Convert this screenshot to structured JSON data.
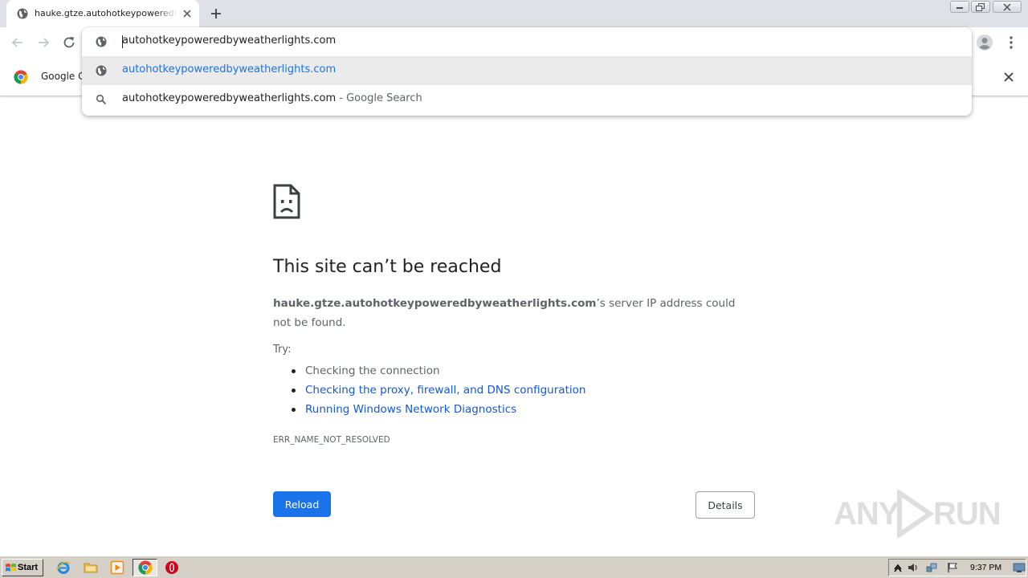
{
  "browser": {
    "tab": {
      "title": "hauke.gtze.autohotkeypoweredbyweatherlights.com"
    },
    "bookmark": {
      "label": "Google Chrome"
    }
  },
  "omnibox": {
    "input_value": "autohotkeypoweredbyweatherlights.com",
    "suggestions": [
      {
        "text": "autohotkeypoweredbyweatherlights.com",
        "suffix": ""
      },
      {
        "text": "autohotkeypoweredbyweatherlights.com",
        "suffix": " - Google Search"
      }
    ]
  },
  "error": {
    "title": "This site can’t be reached",
    "host": "hauke.gtze.autohotkeypoweredbyweatherlights.com",
    "description": "’s server IP address could not be found.",
    "try_label": "Try:",
    "suggestions": [
      "Checking the connection",
      "Checking the proxy, firewall, and DNS configuration",
      "Running Windows Network Diagnostics"
    ],
    "code": "ERR_NAME_NOT_RESOLVED",
    "reload_label": "Reload",
    "details_label": "Details"
  },
  "watermark": {
    "left": "ANY",
    "right": "RUN"
  },
  "taskbar": {
    "start_label": "Start",
    "clock": "9:37 PM"
  },
  "colors": {
    "accent": "#1a73e8",
    "link": "#1558d6",
    "text_secondary": "#5f6368"
  }
}
